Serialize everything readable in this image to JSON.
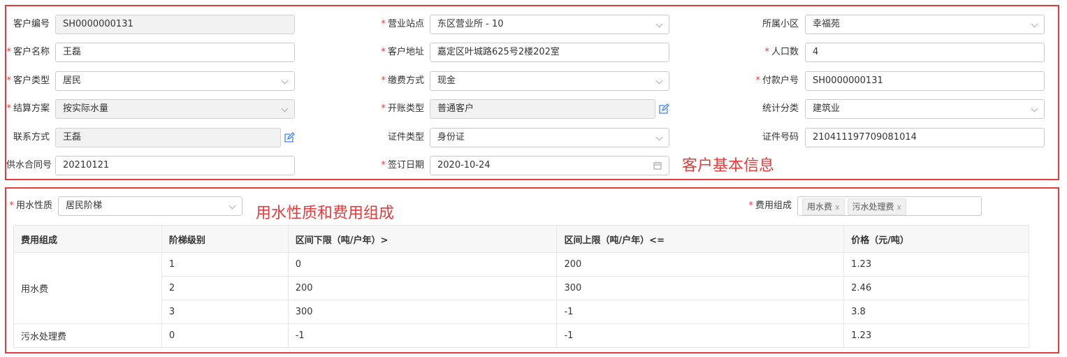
{
  "annotations": {
    "basic_info": "客户基本信息",
    "water_fee": "用水性质和费用组成"
  },
  "basic": {
    "customer_no": {
      "label": "客户编号",
      "value": "SH0000000131",
      "required": false
    },
    "station": {
      "label": "营业站点",
      "value": "东区营业所 - 10",
      "required": true
    },
    "community": {
      "label": "所属小区",
      "value": "幸福苑",
      "required": false
    },
    "customer_name": {
      "label": "客户名称",
      "value": "王磊",
      "required": true
    },
    "customer_address": {
      "label": "客户地址",
      "value": "嘉定区叶城路625号2楼202室",
      "required": true
    },
    "population": {
      "label": "人口数",
      "value": "4",
      "required": true
    },
    "customer_type": {
      "label": "客户类型",
      "value": "居民",
      "required": true
    },
    "payment_method": {
      "label": "缴费方式",
      "value": "现金",
      "required": true
    },
    "payer_no": {
      "label": "付款户号",
      "value": "SH0000000131",
      "required": true
    },
    "settlement": {
      "label": "结算方案",
      "value": "按实际水量",
      "required": true
    },
    "billing_type": {
      "label": "开账类型",
      "value": "普通客户",
      "required": true
    },
    "stat_category": {
      "label": "统计分类",
      "value": "建筑业",
      "required": false
    },
    "contact": {
      "label": "联系方式",
      "value": "王磊",
      "required": false
    },
    "id_type": {
      "label": "证件类型",
      "value": "身份证",
      "required": false
    },
    "id_no": {
      "label": "证件号码",
      "value": "210411197709081014",
      "required": false
    },
    "contract_no": {
      "label": "供水合同号",
      "value": "20210121",
      "required": false
    },
    "sign_date": {
      "label": "签订日期",
      "value": "2020-10-24",
      "required": true
    }
  },
  "water": {
    "nature": {
      "label": "用水性质",
      "value": "居民阶梯"
    },
    "fee_comp": {
      "label": "费用组成",
      "tags": [
        "用水费",
        "污水处理费"
      ],
      "tag_close": "x"
    },
    "table": {
      "headers": [
        "费用组成",
        "阶梯级别",
        "区间下限（吨/户年）>",
        "区间上限（吨/户年）<=",
        "价格（元/吨）"
      ],
      "groups": [
        {
          "name": "用水费",
          "rows": [
            [
              "1",
              "0",
              "200",
              "1.23"
            ],
            [
              "2",
              "200",
              "300",
              "2.46"
            ],
            [
              "3",
              "300",
              "-1",
              "3.8"
            ]
          ]
        },
        {
          "name": "污水处理费",
          "rows": [
            [
              "0",
              "-1",
              "-1",
              "1.23"
            ]
          ]
        }
      ]
    }
  },
  "colors": {
    "accent": "#e33b3b",
    "edit_icon": "#3b82f6"
  }
}
